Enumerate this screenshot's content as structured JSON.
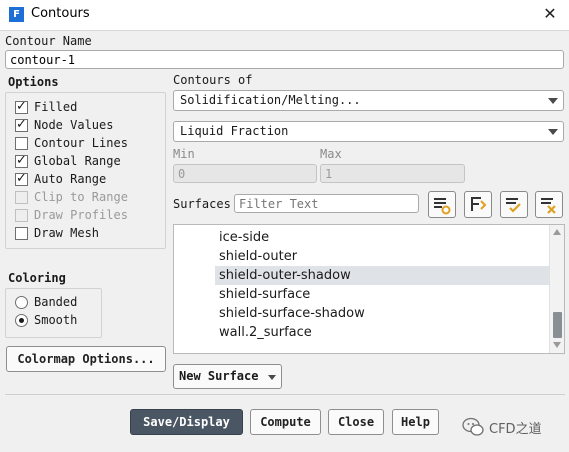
{
  "window": {
    "title": "Contours",
    "app_icon_letter": "F"
  },
  "contour_name": {
    "label": "Contour Name",
    "value": "contour-1"
  },
  "options": {
    "label": "Options",
    "items": [
      {
        "label": "Filled",
        "checked": true,
        "enabled": true
      },
      {
        "label": "Node Values",
        "checked": true,
        "enabled": true
      },
      {
        "label": "Contour Lines",
        "checked": false,
        "enabled": true
      },
      {
        "label": "Global Range",
        "checked": true,
        "enabled": true
      },
      {
        "label": "Auto Range",
        "checked": true,
        "enabled": true
      },
      {
        "label": "Clip to Range",
        "checked": false,
        "enabled": false
      },
      {
        "label": "Draw Profiles",
        "checked": false,
        "enabled": false
      },
      {
        "label": "Draw Mesh",
        "checked": false,
        "enabled": true
      }
    ]
  },
  "contours_of": {
    "label": "Contours of",
    "category": "Solidification/Melting...",
    "quantity": "Liquid Fraction"
  },
  "range": {
    "min_label": "Min",
    "min_value": "0",
    "max_label": "Max",
    "max_value": "1"
  },
  "surfaces": {
    "label": "Surfaces",
    "filter_placeholder": "Filter Text",
    "icons": [
      "select-all-icon",
      "scroll-to-selected-icon",
      "check-all-icon",
      "deselect-all-icon"
    ],
    "items": [
      {
        "label": "ice-side",
        "selected": false
      },
      {
        "label": "shield-outer",
        "selected": false
      },
      {
        "label": "shield-outer-shadow",
        "selected": true
      },
      {
        "label": "shield-surface",
        "selected": false
      },
      {
        "label": "shield-surface-shadow",
        "selected": false
      },
      {
        "label": "wall.2_surface",
        "selected": false
      }
    ],
    "new_surface_label": "New Surface"
  },
  "coloring": {
    "label": "Coloring",
    "options": [
      {
        "label": "Banded",
        "selected": false
      },
      {
        "label": "Smooth",
        "selected": true
      }
    ]
  },
  "colormap_button": "Colormap Options...",
  "footer": {
    "save_display": "Save/Display",
    "compute": "Compute",
    "close": "Close",
    "help": "Help"
  },
  "watermark": {
    "text": "CFD之道"
  }
}
